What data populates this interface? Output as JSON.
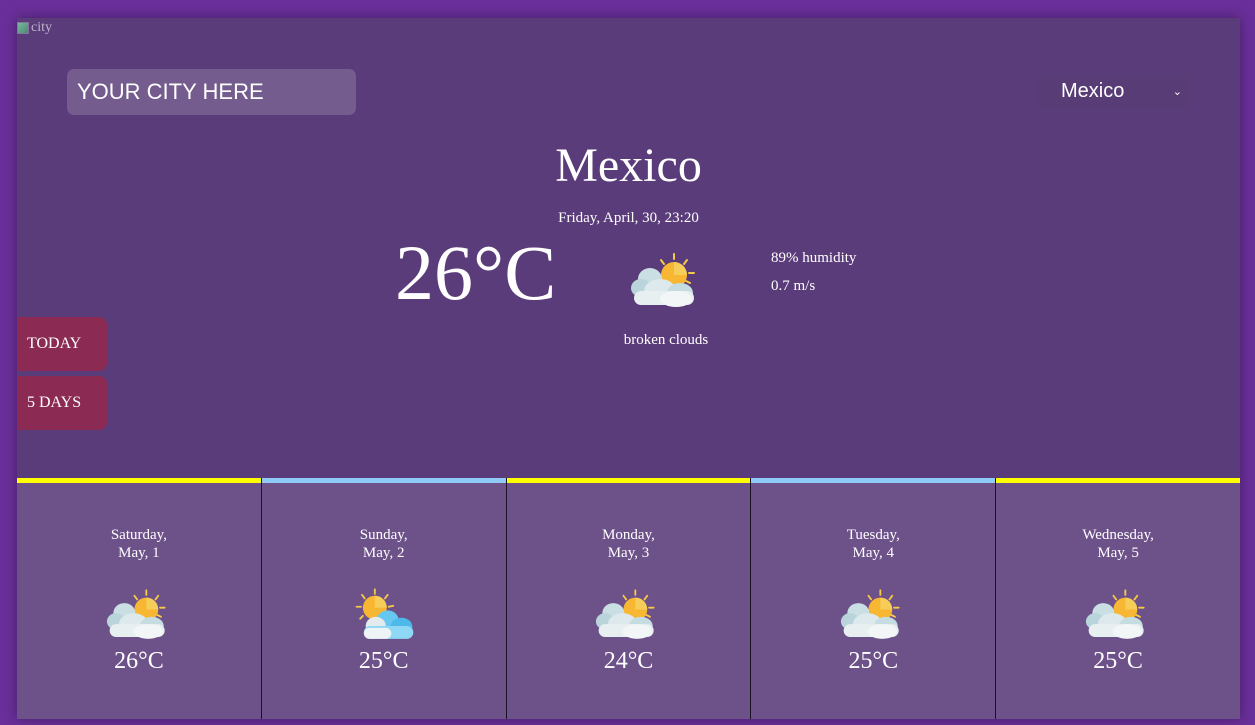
{
  "image_alt": "city",
  "search": {
    "placeholder": "YOUR CITY HERE"
  },
  "country_select": {
    "selected": "Mexico"
  },
  "current": {
    "city": "Mexico",
    "datetime": "Friday, April, 30, 23:20",
    "temperature": "26°C",
    "humidity": "89% humidity",
    "wind": "0.7 m/s",
    "description": "broken clouds",
    "icon": "cloud-sun-icon"
  },
  "nav": {
    "today_label": "TODAY",
    "five_days_label": "5 DAYS"
  },
  "colors": {
    "accent_yellow": "#ffff00",
    "accent_blue": "#90caf9",
    "nav_button": "#8b2a52",
    "panel": "#5b3c7a"
  },
  "forecast": [
    {
      "day": "Saturday,",
      "date": "May, 1",
      "temp": "26°C",
      "icon": "cloud-sun-icon",
      "bar": "#ffff00"
    },
    {
      "day": "Sunday,",
      "date": "May, 2",
      "temp": "25°C",
      "icon": "sun-cloud-blue-icon",
      "bar": "#90caf9"
    },
    {
      "day": "Monday,",
      "date": "May, 3",
      "temp": "24°C",
      "icon": "cloud-sun-icon",
      "bar": "#ffff00"
    },
    {
      "day": "Tuesday,",
      "date": "May, 4",
      "temp": "25°C",
      "icon": "cloud-sun-icon",
      "bar": "#90caf9"
    },
    {
      "day": "Wednesday,",
      "date": "May, 5",
      "temp": "25°C",
      "icon": "cloud-sun-icon",
      "bar": "#ffff00"
    }
  ]
}
